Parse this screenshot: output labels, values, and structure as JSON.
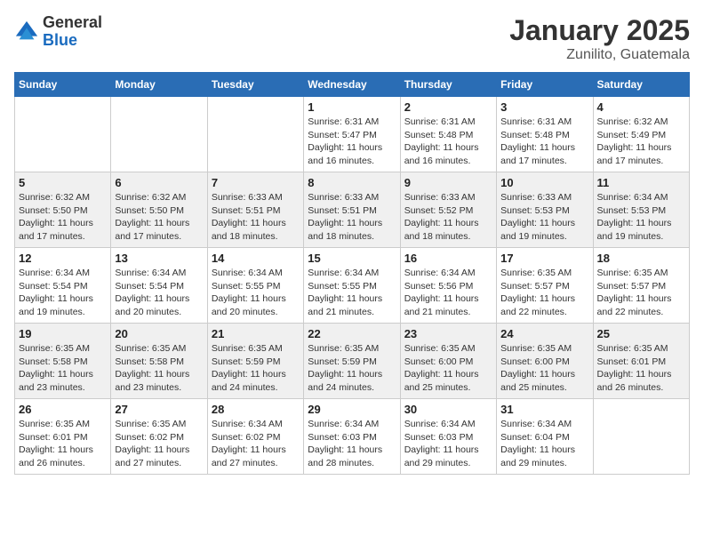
{
  "logo": {
    "general": "General",
    "blue": "Blue"
  },
  "title": "January 2025",
  "location": "Zunilito, Guatemala",
  "weekdays": [
    "Sunday",
    "Monday",
    "Tuesday",
    "Wednesday",
    "Thursday",
    "Friday",
    "Saturday"
  ],
  "weeks": [
    [
      {
        "day": "",
        "info": ""
      },
      {
        "day": "",
        "info": ""
      },
      {
        "day": "",
        "info": ""
      },
      {
        "day": "1",
        "info": "Sunrise: 6:31 AM\nSunset: 5:47 PM\nDaylight: 11 hours and 16 minutes."
      },
      {
        "day": "2",
        "info": "Sunrise: 6:31 AM\nSunset: 5:48 PM\nDaylight: 11 hours and 16 minutes."
      },
      {
        "day": "3",
        "info": "Sunrise: 6:31 AM\nSunset: 5:48 PM\nDaylight: 11 hours and 17 minutes."
      },
      {
        "day": "4",
        "info": "Sunrise: 6:32 AM\nSunset: 5:49 PM\nDaylight: 11 hours and 17 minutes."
      }
    ],
    [
      {
        "day": "5",
        "info": "Sunrise: 6:32 AM\nSunset: 5:50 PM\nDaylight: 11 hours and 17 minutes."
      },
      {
        "day": "6",
        "info": "Sunrise: 6:32 AM\nSunset: 5:50 PM\nDaylight: 11 hours and 17 minutes."
      },
      {
        "day": "7",
        "info": "Sunrise: 6:33 AM\nSunset: 5:51 PM\nDaylight: 11 hours and 18 minutes."
      },
      {
        "day": "8",
        "info": "Sunrise: 6:33 AM\nSunset: 5:51 PM\nDaylight: 11 hours and 18 minutes."
      },
      {
        "day": "9",
        "info": "Sunrise: 6:33 AM\nSunset: 5:52 PM\nDaylight: 11 hours and 18 minutes."
      },
      {
        "day": "10",
        "info": "Sunrise: 6:33 AM\nSunset: 5:53 PM\nDaylight: 11 hours and 19 minutes."
      },
      {
        "day": "11",
        "info": "Sunrise: 6:34 AM\nSunset: 5:53 PM\nDaylight: 11 hours and 19 minutes."
      }
    ],
    [
      {
        "day": "12",
        "info": "Sunrise: 6:34 AM\nSunset: 5:54 PM\nDaylight: 11 hours and 19 minutes."
      },
      {
        "day": "13",
        "info": "Sunrise: 6:34 AM\nSunset: 5:54 PM\nDaylight: 11 hours and 20 minutes."
      },
      {
        "day": "14",
        "info": "Sunrise: 6:34 AM\nSunset: 5:55 PM\nDaylight: 11 hours and 20 minutes."
      },
      {
        "day": "15",
        "info": "Sunrise: 6:34 AM\nSunset: 5:55 PM\nDaylight: 11 hours and 21 minutes."
      },
      {
        "day": "16",
        "info": "Sunrise: 6:34 AM\nSunset: 5:56 PM\nDaylight: 11 hours and 21 minutes."
      },
      {
        "day": "17",
        "info": "Sunrise: 6:35 AM\nSunset: 5:57 PM\nDaylight: 11 hours and 22 minutes."
      },
      {
        "day": "18",
        "info": "Sunrise: 6:35 AM\nSunset: 5:57 PM\nDaylight: 11 hours and 22 minutes."
      }
    ],
    [
      {
        "day": "19",
        "info": "Sunrise: 6:35 AM\nSunset: 5:58 PM\nDaylight: 11 hours and 23 minutes."
      },
      {
        "day": "20",
        "info": "Sunrise: 6:35 AM\nSunset: 5:58 PM\nDaylight: 11 hours and 23 minutes."
      },
      {
        "day": "21",
        "info": "Sunrise: 6:35 AM\nSunset: 5:59 PM\nDaylight: 11 hours and 24 minutes."
      },
      {
        "day": "22",
        "info": "Sunrise: 6:35 AM\nSunset: 5:59 PM\nDaylight: 11 hours and 24 minutes."
      },
      {
        "day": "23",
        "info": "Sunrise: 6:35 AM\nSunset: 6:00 PM\nDaylight: 11 hours and 25 minutes."
      },
      {
        "day": "24",
        "info": "Sunrise: 6:35 AM\nSunset: 6:00 PM\nDaylight: 11 hours and 25 minutes."
      },
      {
        "day": "25",
        "info": "Sunrise: 6:35 AM\nSunset: 6:01 PM\nDaylight: 11 hours and 26 minutes."
      }
    ],
    [
      {
        "day": "26",
        "info": "Sunrise: 6:35 AM\nSunset: 6:01 PM\nDaylight: 11 hours and 26 minutes."
      },
      {
        "day": "27",
        "info": "Sunrise: 6:35 AM\nSunset: 6:02 PM\nDaylight: 11 hours and 27 minutes."
      },
      {
        "day": "28",
        "info": "Sunrise: 6:34 AM\nSunset: 6:02 PM\nDaylight: 11 hours and 27 minutes."
      },
      {
        "day": "29",
        "info": "Sunrise: 6:34 AM\nSunset: 6:03 PM\nDaylight: 11 hours and 28 minutes."
      },
      {
        "day": "30",
        "info": "Sunrise: 6:34 AM\nSunset: 6:03 PM\nDaylight: 11 hours and 29 minutes."
      },
      {
        "day": "31",
        "info": "Sunrise: 6:34 AM\nSunset: 6:04 PM\nDaylight: 11 hours and 29 minutes."
      },
      {
        "day": "",
        "info": ""
      }
    ]
  ]
}
